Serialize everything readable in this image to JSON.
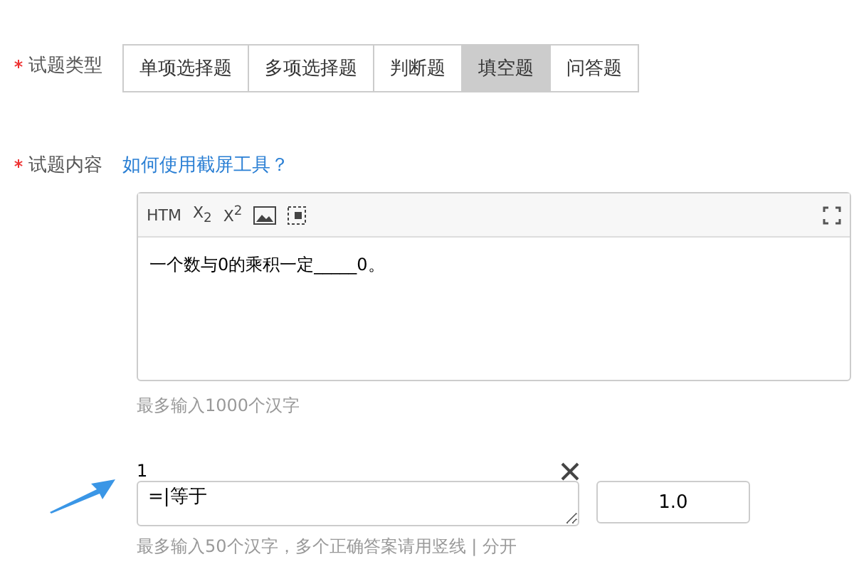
{
  "question_type": {
    "label": "试题类型",
    "required": true,
    "tabs": [
      {
        "label": "单项选择题",
        "selected": false
      },
      {
        "label": "多项选择题",
        "selected": false
      },
      {
        "label": "判断题",
        "selected": false
      },
      {
        "label": "填空题",
        "selected": true
      },
      {
        "label": "问答题",
        "selected": false
      }
    ]
  },
  "content": {
    "label": "试题内容",
    "required": true,
    "help_link": "如何使用截屏工具？",
    "toolbar": [
      {
        "kind": "text",
        "label": "HTM"
      },
      {
        "kind": "text",
        "label": "X$_{2}$"
      },
      {
        "kind": "text",
        "label": "X$^{2}$"
      },
      {
        "kind": "image"
      },
      {
        "kind": "select"
      },
      {
        "kind": "fullscreen"
      }
    ],
    "value": "一个数与0的乘积一定_____0。",
    "hint": "最多输入1000个汉字"
  },
  "answers": [
    {
      "number": "1",
      "value": "=|等于",
      "score": "1.0",
      "hint": "最多输入50个汉字，多个正确答案请用竖线 | 分开"
    }
  ]
}
